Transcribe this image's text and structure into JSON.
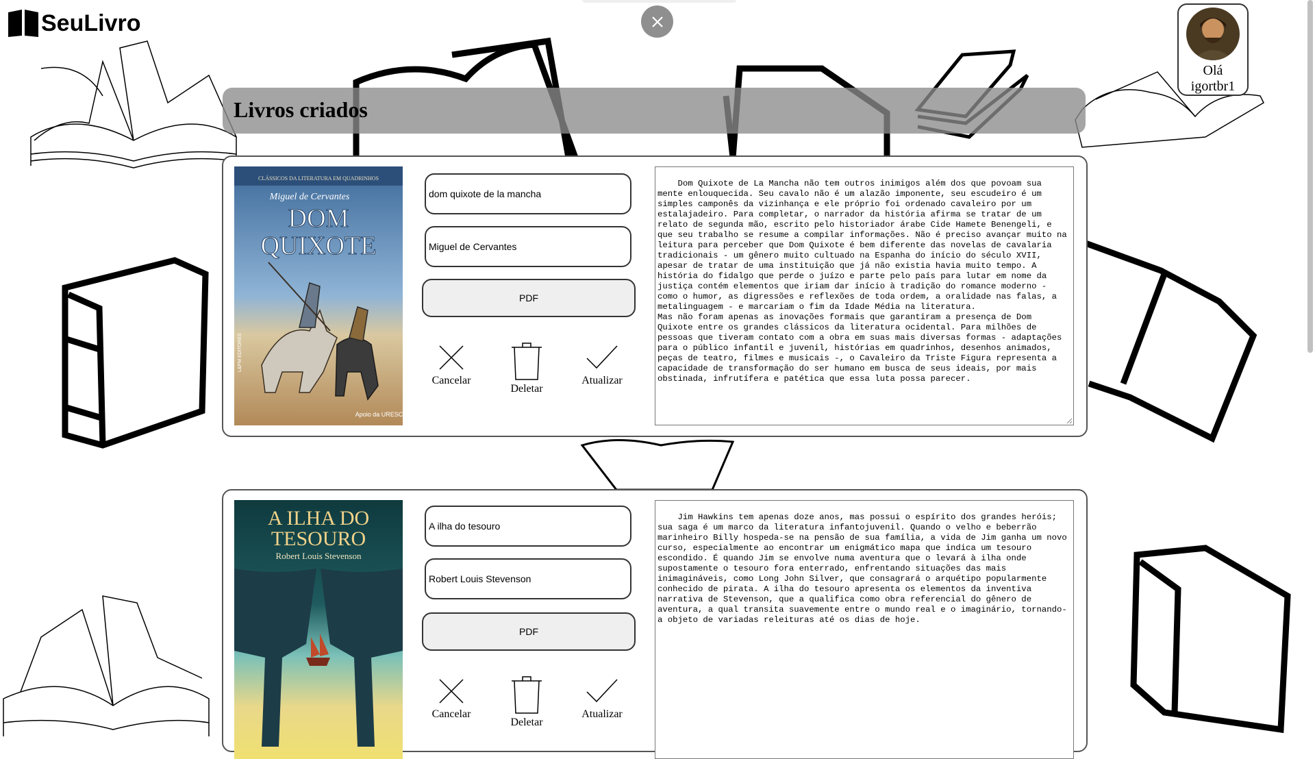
{
  "app": {
    "name": "SeuLivro"
  },
  "user": {
    "greeting": "Olá",
    "username": "igortbr1"
  },
  "section": {
    "title": "Livros criados"
  },
  "actions": {
    "pdf": "PDF",
    "cancel": "Cancelar",
    "delete": "Deletar",
    "update": "Atualizar"
  },
  "books": [
    {
      "title": "dom quixote de la mancha",
      "author": "Miguel de Cervantes",
      "cover": {
        "series": "CLÁSSICOS DA LITERATURA EM QUADRINHOS",
        "author": "Miguel de Cervantes",
        "title_line1": "DOM",
        "title_line2": "QUIXOTE",
        "publisher": "L&PM EDITORES",
        "footer": "Apoio da URESCO"
      },
      "description": "Dom Quixote de La Mancha não tem outros inimigos além dos que povoam sua mente enlouquecida. Seu cavalo não é um alazão imponente, seu escudeiro é um simples camponês da vizinhança e ele próprio foi ordenado cavaleiro por um estalajadeiro. Para completar, o narrador da história afirma se tratar de um relato de segunda mão, escrito pelo historiador árabe Cide Hamete Benengeli, e que seu trabalho se resume a compilar informações. Não é preciso avançar muito na leitura para perceber que Dom Quixote é bem diferente das novelas de cavalaria tradicionais - um gênero muito cultuado na Espanha do início do século XVII, apesar de tratar de uma instituição que já não existia havia muito tempo. A história do fidalgo que perde o juízo e parte pelo país para lutar em nome da justiça contém elementos que iriam dar início à tradição do romance moderno - como o humor, as digressões e reflexões de toda ordem, a oralidade nas falas, a metalinguagem - e marcariam o fim da Idade Média na literatura.\nMas não foram apenas as inovações formais que garantiram a presença de Dom Quixote entre os grandes clássicos da literatura ocidental. Para milhões de pessoas que tiveram contato com a obra em suas mais diversas formas - adaptações para o público infantil e juvenil, histórias em quadrinhos, desenhos animados, peças de teatro, filmes e musicais -, o Cavaleiro da Triste Figura representa a capacidade de transformação do ser humano em busca de seus ideais, por mais obstinada, infrutífera e patética que essa luta possa parecer."
    },
    {
      "title": "A ilha do tesouro",
      "author": "Robert Louis Stevenson",
      "cover": {
        "title_line1": "A ILHA DO",
        "title_line2": "TESOURO",
        "author": "Robert Louis Stevenson"
      },
      "description": "Jim Hawkins tem apenas doze anos, mas possui o espírito dos grandes heróis; sua saga é um marco da literatura infantojuvenil. Quando o velho e beberrão marinheiro Billy hospeda-se na pensão de sua família, a vida de Jim ganha um novo curso, especialmente ao encontrar um enigmático mapa que indica um tesouro escondido. É quando Jim se envolve numa aventura que o levará à ilha onde supostamente o tesouro fora enterrado, enfrentando situações das mais inimagináveis, como Long John Silver, que consagrará o arquétipo popularmente conhecido de pirata. A ilha do tesouro apresenta os elementos da inventiva narrativa de Stevenson, que a qualifica como obra referencial do gênero de aventura, a qual transita suavemente entre o mundo real e o imaginário, tornando-a objeto de variadas releituras até os dias de hoje."
    }
  ],
  "colors": {
    "header_bg": "#8c8c8c",
    "close_btn": "#8f8f8f",
    "pdf_bg": "#efefef",
    "border": "#333333"
  }
}
